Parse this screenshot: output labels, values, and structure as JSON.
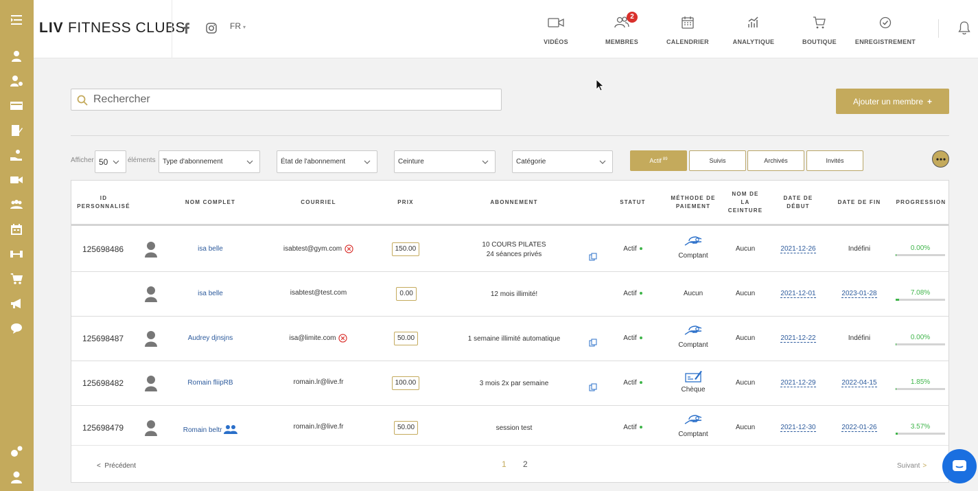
{
  "header": {
    "logo_bold": "LIV",
    "logo_rest": "FITNESS CLUBS",
    "language": "FR",
    "nav": [
      {
        "label": "VIDÉOS",
        "icon": "video-icon"
      },
      {
        "label": "MEMBRES",
        "icon": "members-icon",
        "badge": "2"
      },
      {
        "label": "CALENDRIER",
        "icon": "calendar-icon"
      },
      {
        "label": "ANALYTIQUE",
        "icon": "analytics-icon"
      },
      {
        "label": "BOUTIQUE",
        "icon": "cart-icon"
      },
      {
        "label": "ENREGISTREMENT",
        "icon": "checkin-icon"
      }
    ]
  },
  "search": {
    "placeholder": "Rechercher"
  },
  "add_button": {
    "label": "Ajouter un membre",
    "icon": "+"
  },
  "filters": {
    "show_label": "Afficher",
    "page_size": "50",
    "elements_label": "éléments",
    "subscription_type": "Type d'abonnement",
    "subscription_state": "État de l'abonnement",
    "belt": "Ceinture",
    "category": "Catégorie"
  },
  "tabs": [
    {
      "label": "Actif",
      "count": "89",
      "active": true
    },
    {
      "label": "Suivis"
    },
    {
      "label": "Archivés"
    },
    {
      "label": "Invités"
    }
  ],
  "table": {
    "headers": {
      "id": [
        "ID",
        "PERSONNALISÉ"
      ],
      "name": "NOM COMPLET",
      "email": "COURRIEL",
      "price": "PRIX",
      "subscription": "ABONNEMENT",
      "status": "STATUT",
      "payment": [
        "MÉTHODE DE",
        "PAIEMENT"
      ],
      "belt": [
        "NOM DE",
        "LA",
        "CEINTURE"
      ],
      "start": [
        "DATE DE",
        "DÉBUT"
      ],
      "end": "DATE DE FIN",
      "progress": "PROGRESSION"
    },
    "rows": [
      {
        "id": "125698486",
        "name": "isa belle",
        "email": "isabtest@gym.com",
        "email_error": true,
        "price": "150.00",
        "subscription": [
          "10 COURS PILATES",
          "24 séances privés"
        ],
        "copy": true,
        "status": "Actif",
        "payment": "Comptant",
        "payment_icon": "cash-icon",
        "belt": "Aucun",
        "start": "2021-12-26",
        "end": "Indéfini",
        "end_link": false,
        "progress": "0.00%",
        "progress_value": 0.0
      },
      {
        "id": "",
        "name": "isa belle",
        "email": "isabtest@test.com",
        "email_error": false,
        "price": "0.00",
        "subscription": [
          "12 mois illimité!"
        ],
        "copy": false,
        "status": "Actif",
        "payment": "Aucun",
        "payment_icon": "",
        "belt": "Aucun",
        "start": "2021-12-01",
        "end": "2023-01-28",
        "end_link": true,
        "progress": "7.08%",
        "progress_value": 7.08
      },
      {
        "id": "125698487",
        "name": "Audrey djnsjns",
        "email": "isa@limite.com",
        "email_error": true,
        "price": "50.00",
        "subscription": [
          "1 semaine illimité automatique"
        ],
        "copy": true,
        "status": "Actif",
        "payment": "Comptant",
        "payment_icon": "cash-icon",
        "belt": "Aucun",
        "start": "2021-12-22",
        "end": "Indéfini",
        "end_link": false,
        "progress": "0.00%",
        "progress_value": 0.0
      },
      {
        "id": "125698482",
        "name": "Romain fliipRB",
        "email": "romain.lr@live.fr",
        "email_error": false,
        "price": "100.00",
        "subscription": [
          "3 mois 2x par semaine"
        ],
        "copy": true,
        "status": "Actif",
        "payment": "Chèque",
        "payment_icon": "cheque-icon",
        "belt": "Aucun",
        "start": "2021-12-29",
        "end": "2022-04-15",
        "end_link": true,
        "progress": "1.85%",
        "progress_value": 1.85
      },
      {
        "id": "125698479",
        "name": "Romain beltr",
        "email": "romain.lr@live.fr",
        "email_error": false,
        "price": "50.00",
        "subscription": [
          "session test"
        ],
        "copy": false,
        "status": "Actif",
        "payment": "Comptant",
        "payment_icon": "cash-icon",
        "belt": "Aucun",
        "start": "2021-12-30",
        "end": "2022-01-26",
        "end_link": true,
        "progress": "3.57%",
        "progress_value": 3.57,
        "family": true
      }
    ]
  },
  "pagination": {
    "prev": "Précédent",
    "pages": [
      "1",
      "2"
    ],
    "current": "1",
    "next": "Suivant"
  },
  "colors": {
    "accent": "#c4aa5c",
    "link": "#2c5a9c",
    "success": "#3fb54a",
    "danger": "#d9302c",
    "chat": "#1a6fe0"
  }
}
